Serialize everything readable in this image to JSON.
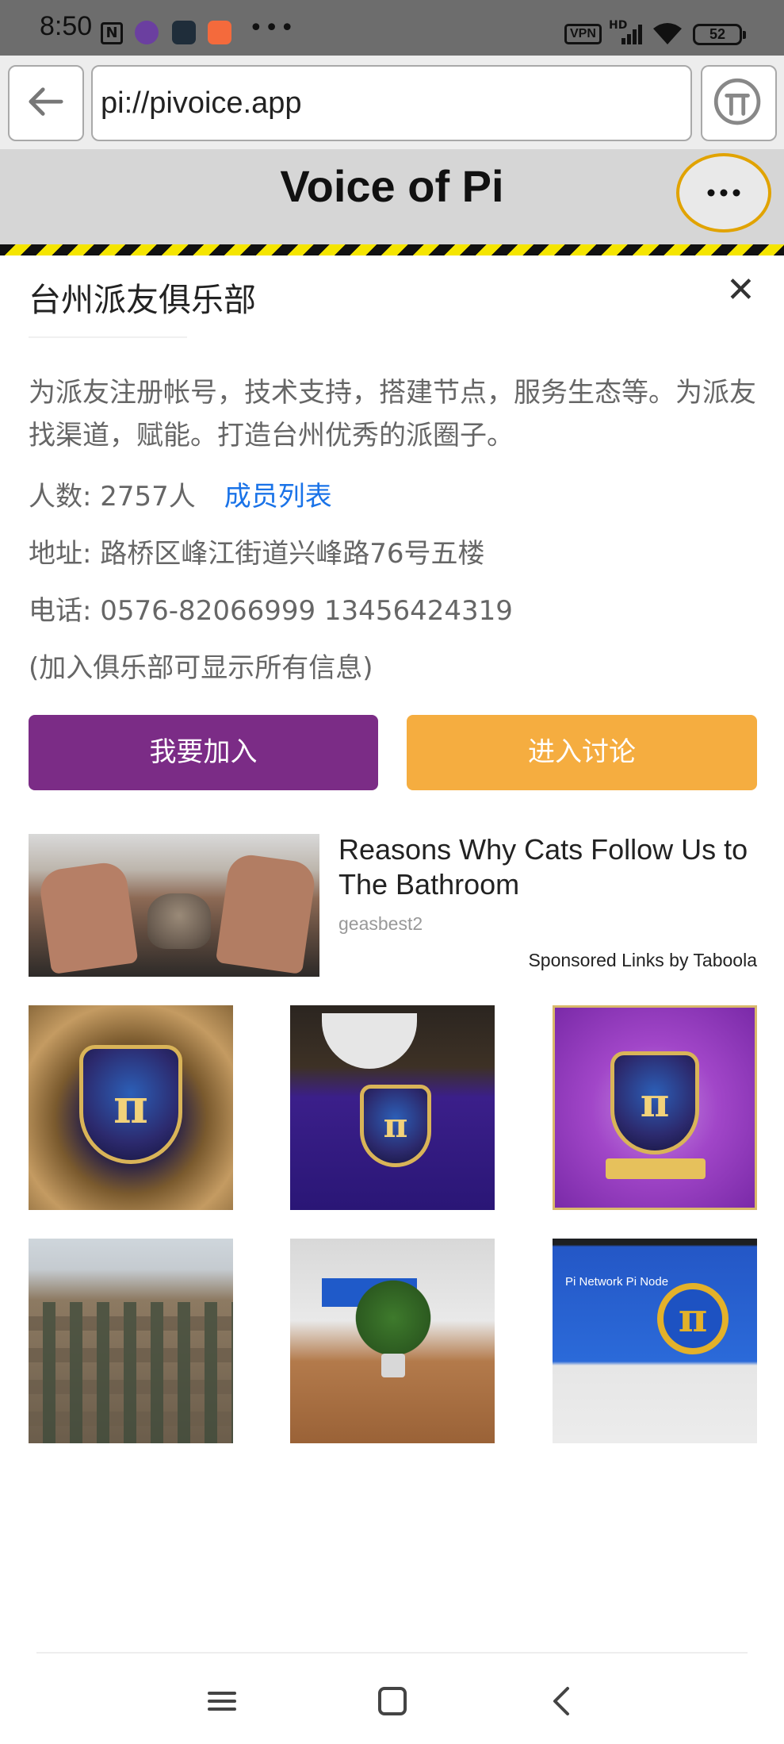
{
  "status_bar": {
    "time": "8:50",
    "battery": "52",
    "vpn": "VPN",
    "hd": "HD"
  },
  "browser": {
    "url": "pi://pivoice.app"
  },
  "app": {
    "title": "Voice of Pi",
    "accent_color": "#e1a300"
  },
  "club": {
    "name": "台州派友俱乐部",
    "description": "为派友注册帐号，技术支持，搭建节点，服务生态等。为派友找渠道，赋能。打造台州优秀的派圈子。",
    "member_count": "人数: 2757人",
    "member_list_link": "成员列表",
    "address": "地址: 路桥区峰江街道兴峰路76号五楼",
    "phone": "电话: 0576-82066999 13456424319",
    "note": "(加入俱乐部可显示所有信息)",
    "join_button": "我要加入",
    "discuss_button": "进入讨论",
    "join_color": "#7b2c86",
    "discuss_color": "#f5ad40"
  },
  "ad": {
    "title": "Reasons Why Cats Follow Us to The Bathroom",
    "source": "geasbest2",
    "sponsor": "Sponsored Links by Taboola"
  },
  "photos": {
    "p6_caption": "Pi Network Pi Node"
  }
}
